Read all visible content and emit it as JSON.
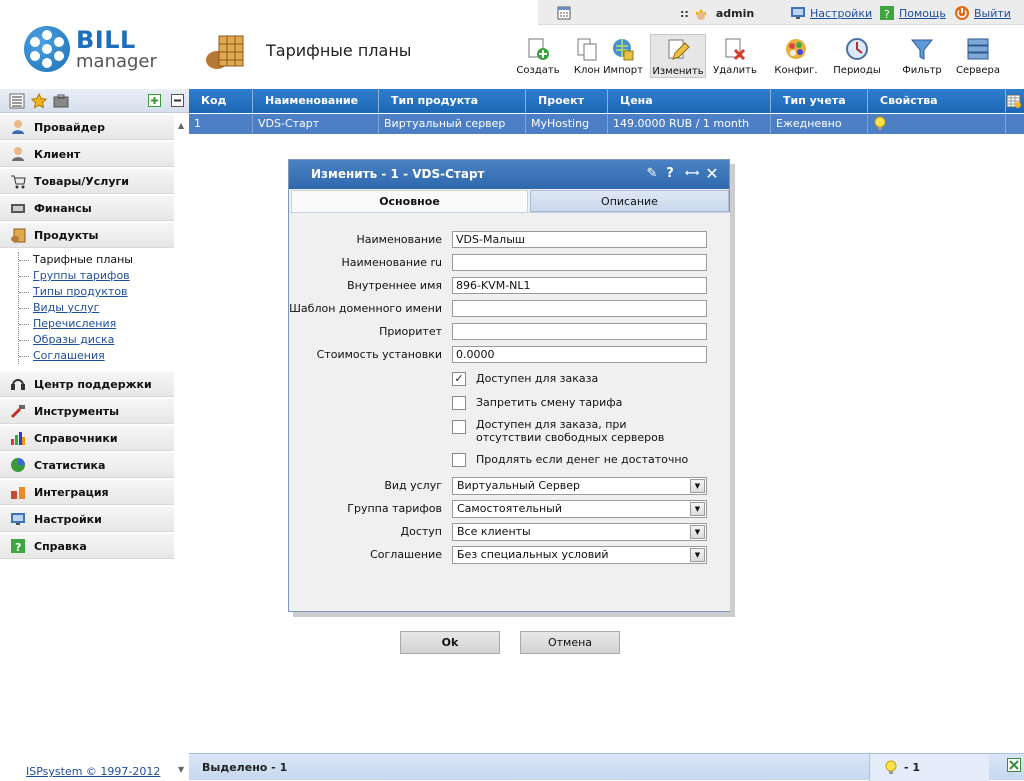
{
  "userbar": {
    "calendar_icon": "calendar-icon",
    "separator": "::",
    "user": "admin",
    "settings": "Настройки",
    "help": "Помощь",
    "logout": "Выйти"
  },
  "logo": {
    "bill": "BILL",
    "manager": "manager"
  },
  "page": {
    "title": "Тарифные планы"
  },
  "toolbar": [
    {
      "label": "Создать",
      "icon": "create-icon"
    },
    {
      "label": "Клон",
      "icon": "clone-icon"
    },
    {
      "label": "Импорт",
      "icon": "import-icon"
    },
    {
      "label": "Изменить",
      "icon": "edit-icon",
      "active": true
    },
    {
      "label": "Удалить",
      "icon": "delete-icon"
    },
    {
      "label": "Конфиг.",
      "icon": "config-icon"
    },
    {
      "label": "Периоды",
      "icon": "periods-icon"
    },
    {
      "label": "Фильтр",
      "icon": "filter-icon"
    },
    {
      "label": "Сервера",
      "icon": "servers-icon"
    }
  ],
  "sidebar": {
    "sections_top": [
      {
        "label": "Провайдер",
        "icon": "provider-icon"
      },
      {
        "label": "Клиент",
        "icon": "client-icon"
      },
      {
        "label": "Товары/Услуги",
        "icon": "cart-icon"
      },
      {
        "label": "Финансы",
        "icon": "finance-icon"
      },
      {
        "label": "Продукты",
        "icon": "products-icon"
      }
    ],
    "products_items": [
      "Тарифные планы",
      "Группы тарифов",
      "Типы продуктов",
      "Виды услуг",
      "Перечисления",
      "Образы диска",
      "Соглашения"
    ],
    "sections_bottom": [
      {
        "label": "Центр поддержки",
        "icon": "support-icon"
      },
      {
        "label": "Инструменты",
        "icon": "tools-icon"
      },
      {
        "label": "Справочники",
        "icon": "reference-icon"
      },
      {
        "label": "Статистика",
        "icon": "statistics-icon"
      },
      {
        "label": "Интеграция",
        "icon": "integration-icon"
      },
      {
        "label": "Настройки",
        "icon": "settings-icon"
      },
      {
        "label": "Справка",
        "icon": "help-icon"
      }
    ],
    "footer": "ISPsystem © 1997-2012"
  },
  "table": {
    "columns": [
      "Код",
      "Наименование",
      "Тип продукта",
      "Проект",
      "Цена",
      "Тип учета",
      "Свойства"
    ],
    "rows": [
      [
        "1",
        "VDS-Старт",
        "Виртуальный сервер",
        "MyHosting",
        "149.0000 RUB / 1 month",
        "Ежедневно",
        ""
      ]
    ]
  },
  "status": {
    "selected": "Выделено - 1",
    "bulb_count": "- 1"
  },
  "dialog": {
    "title": "Изменить - 1 - VDS-Старт",
    "tabs": [
      "Основное",
      "Описание"
    ],
    "fields": [
      {
        "label": "Наименование",
        "value": "VDS-Малыш"
      },
      {
        "label": "Наименование ru",
        "value": ""
      },
      {
        "label": "Внутреннее имя",
        "value": "896-KVM-NL1"
      },
      {
        "label": "Шаблон доменного имени",
        "value": ""
      },
      {
        "label": "Приоритет",
        "value": ""
      },
      {
        "label": "Стоимость установки",
        "value": "0.0000"
      }
    ],
    "checkboxes": [
      {
        "label": "Доступен для заказа",
        "checked": true
      },
      {
        "label": "Запретить смену тарифа",
        "checked": false
      },
      {
        "label": "Доступен для заказа, при отсутствии свободных серверов",
        "checked": false
      },
      {
        "label": "Продлять если денег не достаточно",
        "checked": false
      }
    ],
    "selects": [
      {
        "label": "Вид услуг",
        "value": "Виртуальный Сервер"
      },
      {
        "label": "Группа тарифов",
        "value": "Самостоятельный"
      },
      {
        "label": "Доступ",
        "value": "Все клиенты"
      },
      {
        "label": "Соглашение",
        "value": "Без специальных условий"
      }
    ],
    "ok": "Ok",
    "cancel": "Отмена"
  }
}
